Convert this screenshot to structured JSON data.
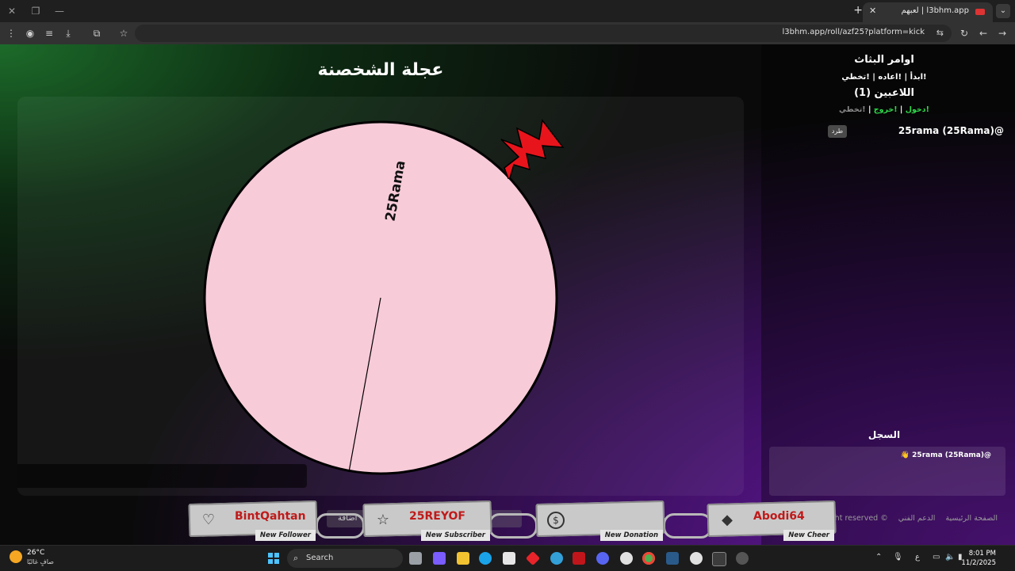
{
  "browser": {
    "tab_title": "l3bhm.app | لعبهم",
    "url": "l3bhm.app/roll/azf25?platform=kick",
    "new_tab": "+",
    "close_tab": "✕"
  },
  "page": {
    "title": "عجلة الشخصنة",
    "wheel_segment_label": "25Rama",
    "wheel_color": "#f8cbd9",
    "pointer_color": "#e8141c"
  },
  "side": {
    "commands_title": "اوامر البثاث",
    "commands": "!ابدأ | !اعاده | !تخطي",
    "players_title": "اللاعبين (1)",
    "player_cmd_join": "!دخول",
    "player_cmd_sep": "|",
    "player_cmd_leave": "!خروج",
    "player_cmd_skip": "!تخطي",
    "player_name": "25rama (25Rama)@",
    "kick_label": "طرد",
    "log_title": "السجل",
    "log_entry": "👋 25rama (25Rama)@"
  },
  "footer": {
    "home": "الصفحة الرئيسية",
    "support": "الدعم الفني",
    "rights": "© ght reserved"
  },
  "alerts": [
    {
      "name": "BintQahtan",
      "type": "New Follower",
      "icon": "heart-icon",
      "glyph": "♡"
    },
    {
      "name": "25REYOF",
      "type": "New Subscriber",
      "icon": "star-icon",
      "glyph": "☆"
    },
    {
      "name": "",
      "type": "New Donation",
      "icon": "coin-icon",
      "glyph": "$"
    },
    {
      "name": "Abodi64",
      "type": "New Cheer",
      "icon": "diamond-icon",
      "glyph": "◆"
    }
  ],
  "ghost_button": "اضافة",
  "taskbar": {
    "temperature": "26°C",
    "weather": "صافٍ غالبًا",
    "search": "Search",
    "time": "8:01 PM",
    "date": "11/2/2025",
    "lang": "ع"
  }
}
